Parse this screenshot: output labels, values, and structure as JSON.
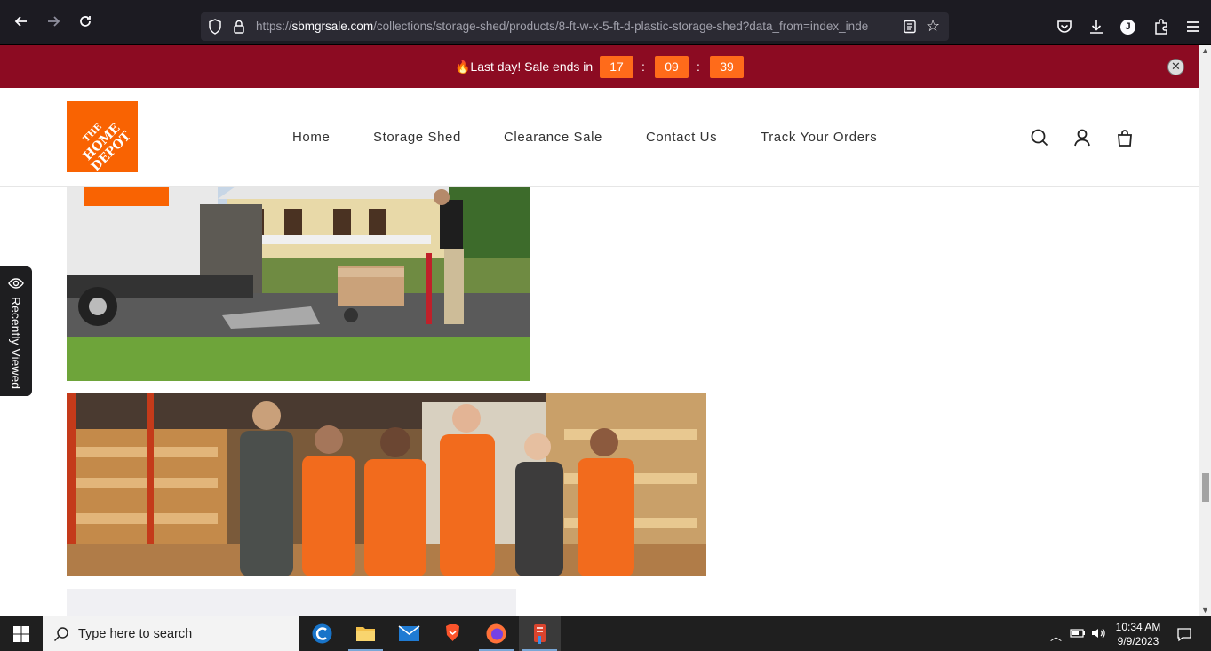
{
  "browser": {
    "url_prefix": "https://",
    "url_host": "sbmgrsale.com",
    "url_path": "/collections/storage-shed/products/8-ft-w-x-5-ft-d-plastic-storage-shed?data_from=index_inde",
    "profile_initial": "J"
  },
  "promo": {
    "text": "🔥Last day! Sale ends in",
    "hours": "17",
    "minutes": "09",
    "seconds": "39",
    "separator": ":",
    "close_symbol": "✕"
  },
  "header": {
    "logo_line1": "THE",
    "logo_line2": "HOME",
    "logo_line3": "DEPOT",
    "nav": [
      {
        "label": "Home"
      },
      {
        "label": "Storage Shed"
      },
      {
        "label": "Clearance Sale"
      },
      {
        "label": "Contact Us"
      },
      {
        "label": "Track Your Orders"
      }
    ]
  },
  "sidebar": {
    "recently_viewed": "Recently Viewed"
  },
  "taskbar": {
    "search_placeholder": "Type here to search",
    "time": "10:34 AM",
    "date": "9/9/2023"
  },
  "colors": {
    "promo_bg": "#8c0b22",
    "countdown_bg": "#ff6b1a",
    "brand_orange": "#f96302"
  }
}
